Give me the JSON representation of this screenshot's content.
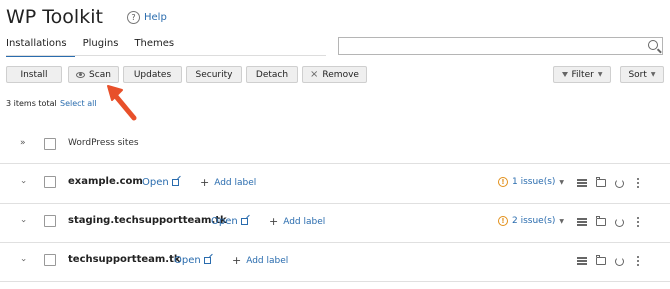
{
  "app": {
    "title": "WP Toolkit",
    "help_label": "Help"
  },
  "tabs": [
    {
      "label": "Installations",
      "active": true
    },
    {
      "label": "Plugins",
      "active": false
    },
    {
      "label": "Themes",
      "active": false
    }
  ],
  "search": {
    "placeholder": "",
    "value": ""
  },
  "toolbar": {
    "install": "Install",
    "scan": "Scan",
    "updates": "Updates",
    "security": "Security",
    "detach": "Detach",
    "remove": "Remove",
    "filter": "Filter",
    "sort": "Sort"
  },
  "summary": {
    "items_total": "3 items total",
    "select_all": "Select all"
  },
  "table": {
    "header": "WordPress sites",
    "rows": [
      {
        "name": "example.com",
        "open": "Open",
        "add_label": "Add label",
        "issues": "1 issue(s)"
      },
      {
        "name": "staging.techsupportteam.tk",
        "open": "Open",
        "add_label": "Add label",
        "issues": "2 issue(s)"
      },
      {
        "name": "techsupportteam.tk",
        "open": "Open",
        "add_label": "Add label",
        "issues": ""
      }
    ]
  },
  "colors": {
    "link": "#2a6cae",
    "warning": "#e2901b",
    "annotation_arrow": "#e8502a"
  }
}
